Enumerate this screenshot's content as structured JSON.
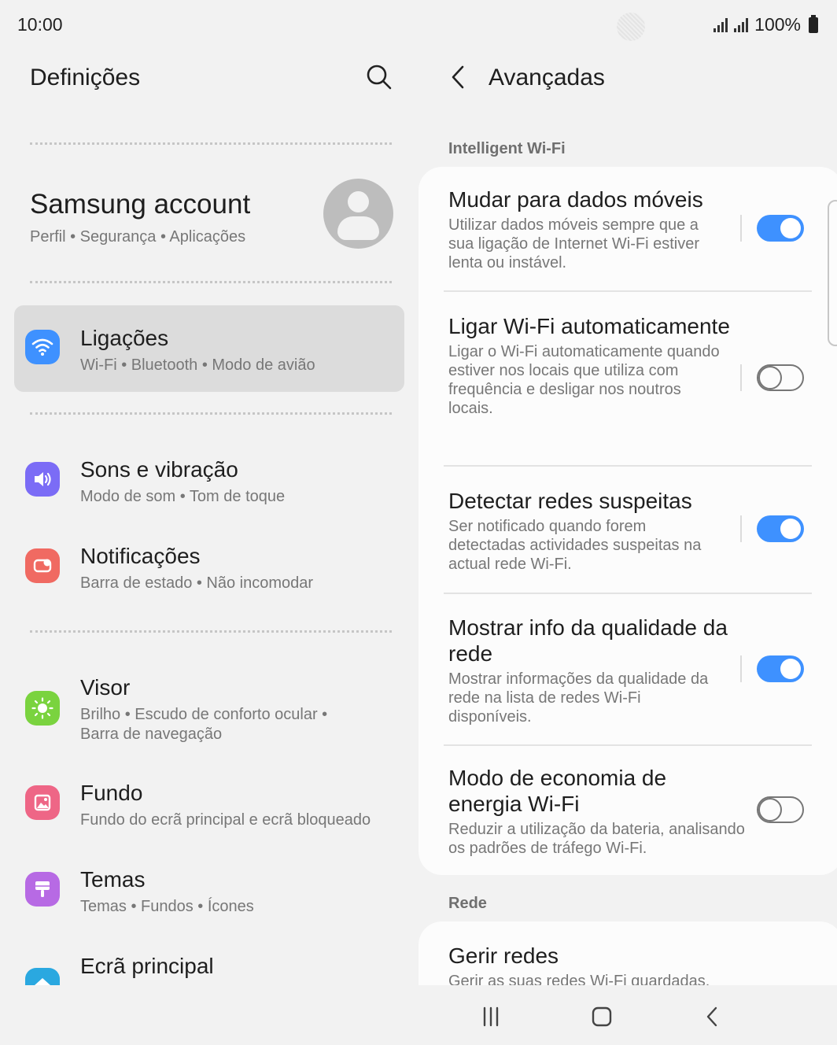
{
  "status_bar": {
    "time": "10:00",
    "battery": "100%"
  },
  "left_pane": {
    "title": "Definições",
    "account": {
      "title": "Samsung account",
      "subtitle": "Perfil  •  Segurança  •  Aplicações"
    },
    "items": [
      {
        "title": "Ligações",
        "subtitle": "Wi-Fi  •  Bluetooth  •  Modo de avião",
        "icon": "wifi-icon",
        "color": "#3e91ff"
      },
      {
        "title": "Sons e vibração",
        "subtitle": "Modo de som  •  Tom de toque",
        "icon": "speaker-icon",
        "color": "#7b6cf6"
      },
      {
        "title": "Notificações",
        "subtitle": "Barra de estado  •  Não incomodar",
        "icon": "notification-icon",
        "color": "#f06a62"
      },
      {
        "title": "Visor",
        "subtitle": "Brilho  •  Escudo de conforto ocular  •  Barra de navegação",
        "icon": "sun-icon",
        "color": "#7ad33f"
      },
      {
        "title": "Fundo",
        "subtitle": "Fundo do ecrã principal e ecrã bloqueado",
        "icon": "picture-icon",
        "color": "#ee6686"
      },
      {
        "title": "Temas",
        "subtitle": "Temas  •  Fundos  •  Ícones",
        "icon": "brush-icon",
        "color": "#b76ae4"
      },
      {
        "title": "Ecrã principal",
        "subtitle": "",
        "icon": "home-icon",
        "color": "#2aa8e0"
      }
    ]
  },
  "right_pane": {
    "title": "Avançadas",
    "sections": [
      {
        "label": "Intelligent Wi-Fi",
        "settings": [
          {
            "title": "Mudar para dados móveis",
            "desc": "Utilizar dados móveis sempre que a sua ligação de Internet Wi-Fi estiver lenta ou instável.",
            "on": true
          },
          {
            "title": "Ligar Wi-Fi automaticamente",
            "desc": "Ligar o Wi-Fi automaticamente quando estiver nos locais que utiliza com frequência e desligar nos noutros locais.",
            "on": false
          },
          {
            "title": "Detectar redes suspeitas",
            "desc": "Ser notificado quando forem detectadas actividades suspeitas na actual rede Wi-Fi.",
            "on": true
          },
          {
            "title": "Mostrar info da qualidade da rede",
            "desc": "Mostrar informações da qualidade da rede na lista de redes Wi-Fi disponíveis.",
            "on": true
          },
          {
            "title": "Modo de economia de energia Wi-Fi",
            "desc": "Reduzir a utilização da bateria, analisando os padrões de tráfego Wi-Fi.",
            "on": false
          }
        ]
      },
      {
        "label": "Rede",
        "settings": [
          {
            "title": "Gerir redes",
            "desc": "Gerir as suas redes Wi-Fi guardadas."
          }
        ]
      }
    ]
  },
  "colors": {
    "accent": "#3e91ff",
    "background": "#f2f2f2",
    "card": "#fcfcfc"
  }
}
